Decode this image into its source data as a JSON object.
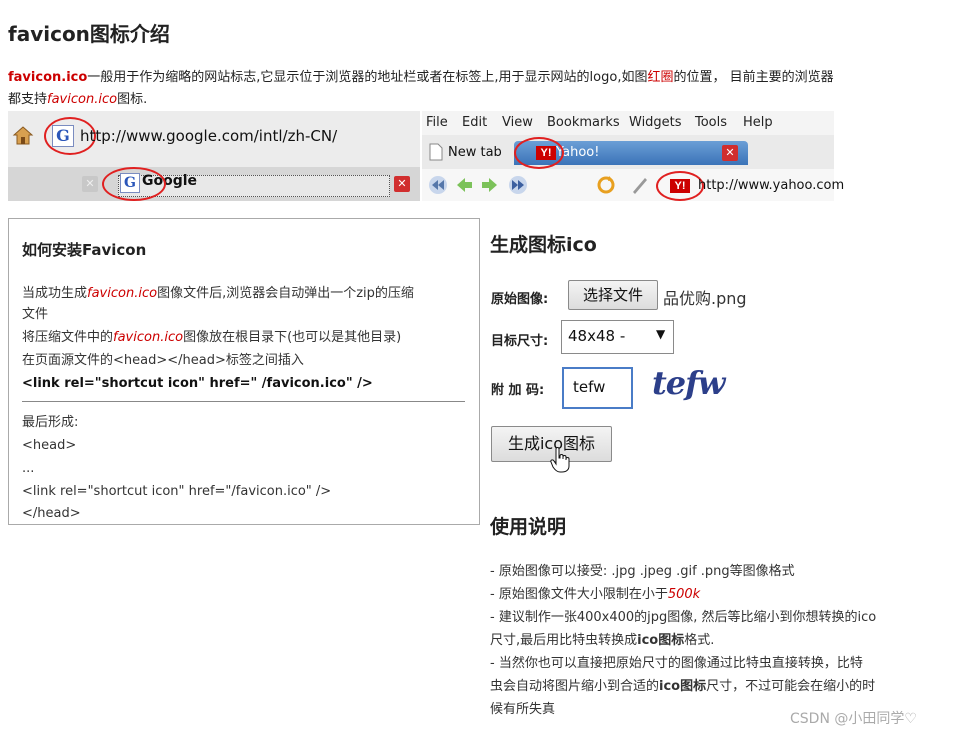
{
  "heading": "favicon图标介绍",
  "intro": {
    "p1_ico": "favicon.ico",
    "p1_text": "一般用于作为缩略的网站标志,它显示位于浏览器的地址栏或者在标签上,用于显示网站的logo,如图",
    "p1_red": "红圈",
    "p1_text2": "的位置， 目前主要的浏览器",
    "p2_text": "都支持",
    "p2_ico": "favicon.ico",
    "p2_text2": "图标."
  },
  "browser_shot": {
    "ie_url": "http://www.google.com/intl/zh-CN/",
    "ie_tab": "Google",
    "g_letter": "G",
    "opera_menu": [
      "File",
      "Edit",
      "View",
      "Bookmarks",
      "Widgets",
      "Tools",
      "Help"
    ],
    "new_tab": "New tab",
    "yahoo_tab": "Yahoo!",
    "yahoo_logo": "Y!",
    "yahoo_url": "http://www.yahoo.com"
  },
  "install": {
    "title": "如何安装Favicon",
    "l1a": "当成功生成",
    "l1_ico": "favicon.ico",
    "l1b": "图像文件后,浏览器会自动弹出一个zip的压缩",
    "l2": "文件",
    "l3a": "将压缩文件中的",
    "l3_ico": "favicon.ico",
    "l3b": "图像放在根目录下(也可以是其他目录)",
    "l4": "在页面源文件的<head></head>标签之间插入",
    "l5": "<link rel=\"shortcut icon\" href=\" /favicon.ico\" />",
    "l6": "最后形成:",
    "l7": "<head>",
    "l8": "...",
    "l9": "<link rel=\"shortcut icon\" href=\"/favicon.ico\" />",
    "l10": "</head>"
  },
  "generator": {
    "title": "生成图标ico",
    "source_label": "原始图像:",
    "choose_file": "选择文件",
    "file_name": "品优购.png",
    "size_label": "目标尺寸:",
    "size_value": "48x48 -",
    "code_label": "附 加 码:",
    "code_value": "tefw",
    "captcha": "tefw",
    "generate_button": "生成ico图标"
  },
  "usage": {
    "title": "使用说明",
    "i1": "- 原始图像可以接受: .jpg .jpeg .gif .png等图像格式",
    "i2a": "- 原始图像文件大小限制在小于",
    "i2_red": "500k",
    "i3": "- 建议制作一张400x400的jpg图像, 然后等比缩小到你想转换的ico",
    "i4a": "尺寸,最后用比特虫转换成",
    "i4_b": "ico图标",
    "i4b": "格式.",
    "i5": "- 当然你也可以直接把原始尺寸的图像通过比特虫直接转换，比特",
    "i6a": "虫会自动将图片缩小到合适的",
    "i6_b": "ico图标",
    "i6b": "尺寸，不过可能会在缩小的时",
    "i7": "候有所失真"
  },
  "watermark": "CSDN @小田同学♡",
  "colors": {
    "accent_red": "#cc0000",
    "text": "#222222",
    "input_border": "#4a7cc7",
    "captcha": "#2c3f8a"
  }
}
